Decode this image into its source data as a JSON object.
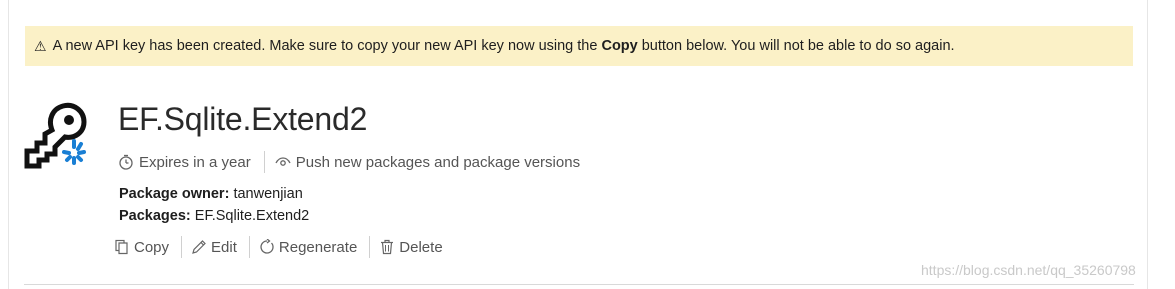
{
  "alert": {
    "icon": "warning-triangle-icon",
    "text_before": "A new API key has been created. Make sure to copy your new API key now using the ",
    "text_bold": "Copy",
    "text_after": " button below. You will not be able to do so again.",
    "background": "#fbf1c7"
  },
  "key": {
    "icon": "key-icon",
    "name": "EF.Sqlite.Extend2",
    "expires": "Expires in a year",
    "scope": "Push new packages and package versions",
    "owner_label": "Package owner:",
    "owner_value": "tanwenjian",
    "packages_label": "Packages:",
    "packages_value": "EF.Sqlite.Extend2"
  },
  "actions": {
    "copy": "Copy",
    "edit": "Edit",
    "regenerate": "Regenerate",
    "delete": "Delete"
  },
  "colors": {
    "accent": "#0078d4",
    "text": "#212121",
    "muted": "#555555"
  },
  "watermark": "https://blog.csdn.net/qq_35260798"
}
